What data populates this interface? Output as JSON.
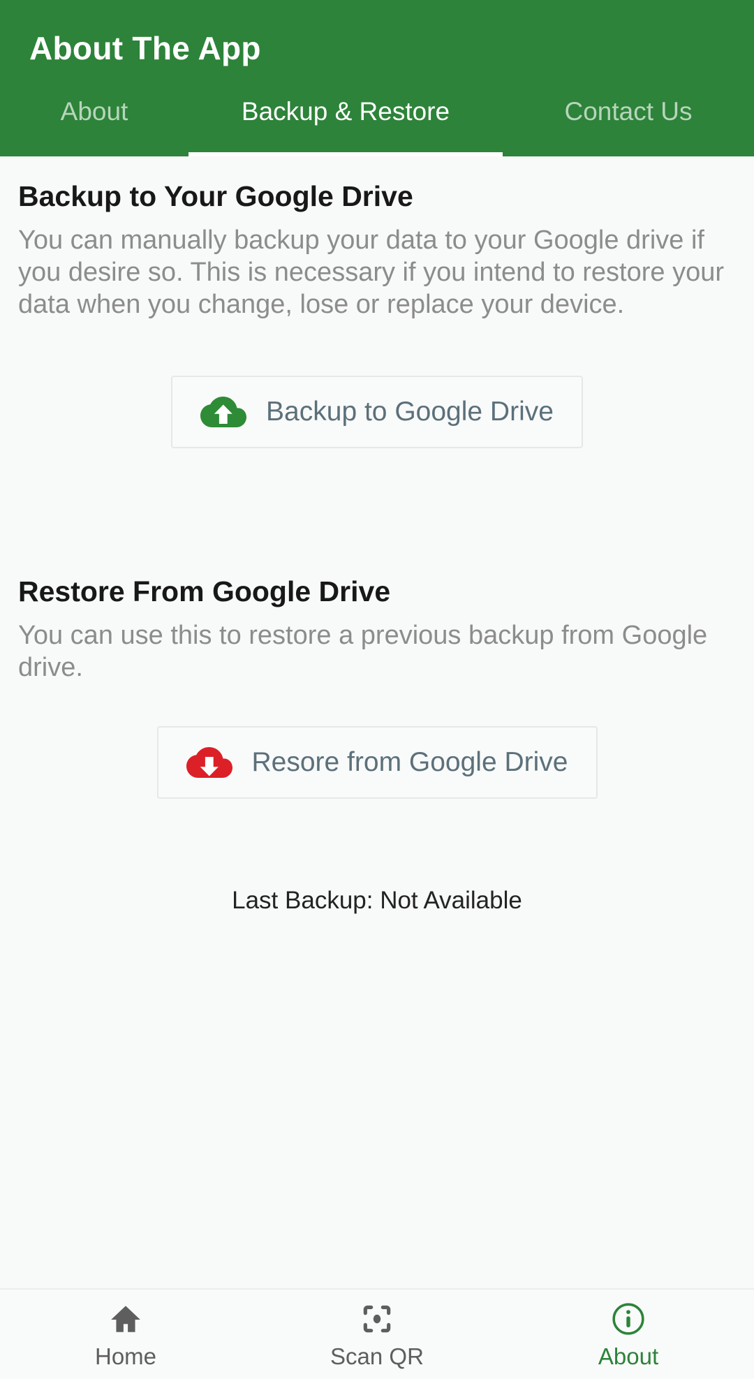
{
  "appbar": {
    "title": "About The App",
    "brand_color": "#2d8339",
    "tabs": [
      {
        "label": "About",
        "active": false
      },
      {
        "label": "Backup & Restore",
        "active": true
      },
      {
        "label": "Contact Us",
        "active": false
      }
    ]
  },
  "main": {
    "backup_section": {
      "title": "Backup to Your Google Drive",
      "body": "You can manually backup your data to your Google drive if you desire so. This is necessary if you intend to restore your data when you change, lose or replace your device.",
      "button_label": "Backup to Google Drive",
      "button_icon": "cloud-upload-icon",
      "icon_color": "#2e8b36",
      "button_text_color": "#5b707a"
    },
    "restore_section": {
      "title": "Restore From Google Drive",
      "body": "You can use this to restore a previous backup from Google drive.",
      "button_label": "Resore from Google Drive",
      "button_icon": "cloud-download-icon",
      "icon_color": "#db2127",
      "button_text_color": "#5b707a"
    },
    "status": {
      "last_backup": "Last Backup: Not Available"
    }
  },
  "bottomnav": {
    "items": [
      {
        "label": "Home",
        "icon": "home-icon",
        "active": false
      },
      {
        "label": "Scan QR",
        "icon": "qr-scan-icon",
        "active": false
      },
      {
        "label": "About",
        "icon": "info-icon",
        "active": true
      }
    ],
    "active_color": "#2d8339",
    "inactive_color": "#5e5e5e"
  }
}
